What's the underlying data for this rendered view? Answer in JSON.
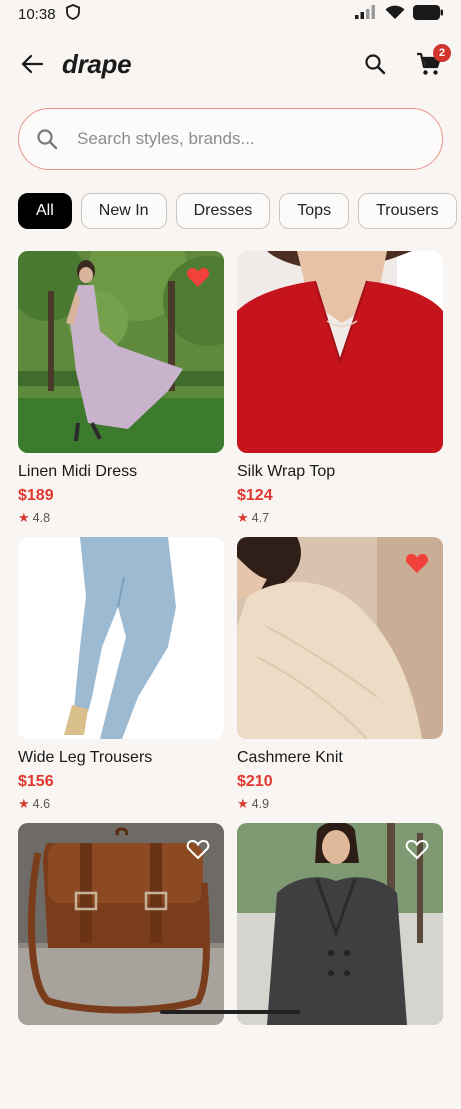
{
  "status": {
    "time": "10:38"
  },
  "header": {
    "title": "drape",
    "cart_count": "2"
  },
  "search": {
    "placeholder": "Search styles, brands..."
  },
  "filters": [
    "All",
    "New In",
    "Dresses",
    "Tops",
    "Trousers"
  ],
  "active_filter": "All",
  "products": [
    {
      "name": "Linen Midi Dress",
      "price": "$189",
      "rating": "4.8",
      "favorited": true
    },
    {
      "name": "Silk Wrap Top",
      "price": "$124",
      "rating": "4.7",
      "favorited": false
    },
    {
      "name": "Wide Leg Trousers",
      "price": "$156",
      "rating": "4.6",
      "favorited": false
    },
    {
      "name": "Cashmere Knit",
      "price": "$210",
      "rating": "4.9",
      "favorited": true
    },
    {
      "name": "",
      "price": "",
      "rating": "",
      "favorited": false
    },
    {
      "name": "",
      "price": "",
      "rating": "",
      "favorited": false
    }
  ],
  "colors": {
    "accent": "#e0382f",
    "heart": "#f0413a",
    "badge": "#d0342c"
  }
}
